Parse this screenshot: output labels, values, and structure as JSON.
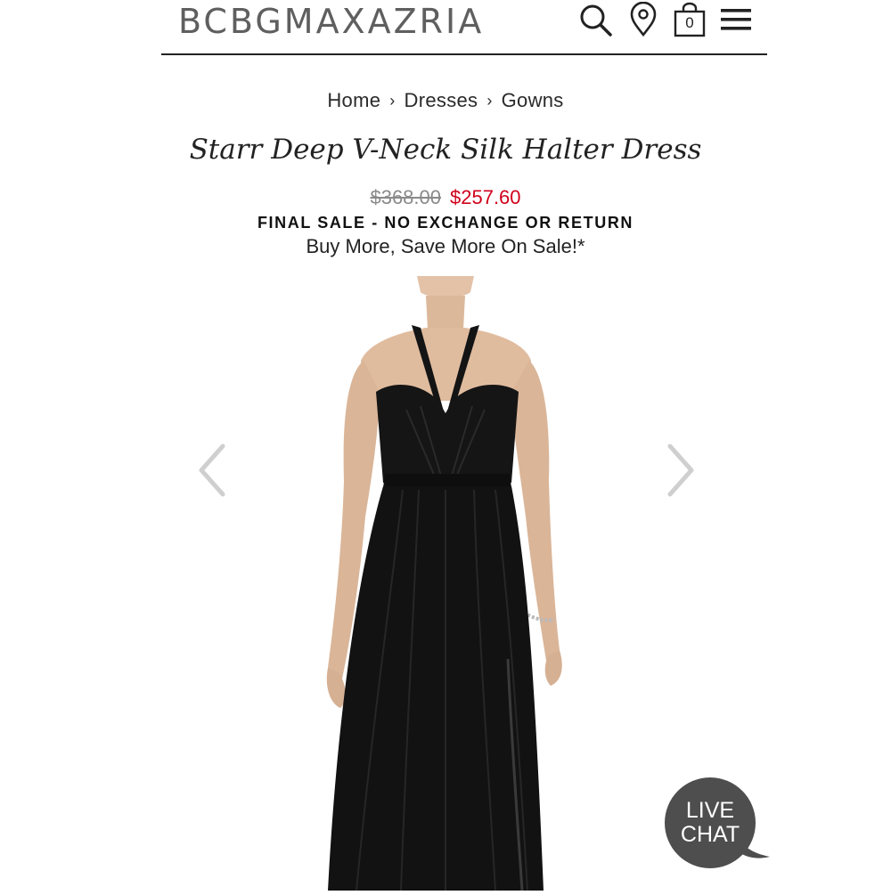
{
  "header": {
    "brand": "BCBGMAXAZRIA",
    "cart_count": "0",
    "icons": [
      "search-icon",
      "location-pin-icon",
      "shopping-bag-icon",
      "menu-icon"
    ]
  },
  "breadcrumb": {
    "items": [
      "Home",
      "Dresses",
      "Gowns"
    ],
    "separator": "›"
  },
  "product": {
    "title": "Starr Deep V-Neck Silk Halter Dress",
    "original_price": "$368.00",
    "sale_price": "$257.60",
    "final_sale_notice": "FINAL SALE - NO EXCHANGE OR RETURN",
    "promo_text": "Buy More, Save More On Sale!*",
    "image": "black-halter-gown-photo"
  },
  "carousel": {
    "prev_icon": "chevron-left-icon",
    "next_icon": "chevron-right-icon"
  },
  "live_chat": {
    "line1": "LIVE",
    "line2": "CHAT"
  },
  "colors": {
    "sale_red": "#d0021b",
    "brand_gray": "#5f5f5f",
    "chat_bubble": "#4e4e4e"
  }
}
